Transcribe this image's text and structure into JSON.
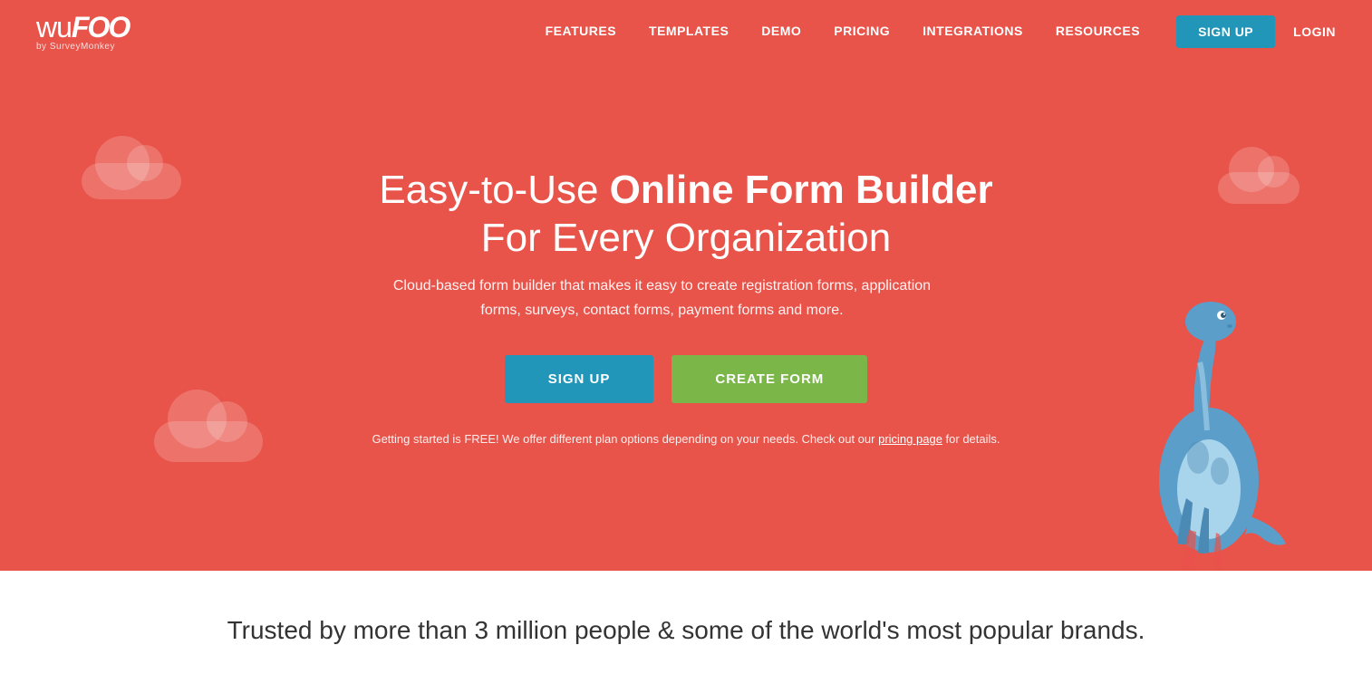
{
  "nav": {
    "logo": "wuFOO",
    "logo_sub": "by SurveyMonkey",
    "links": [
      {
        "label": "FEATURES",
        "href": "#"
      },
      {
        "label": "TEMPLATES",
        "href": "#"
      },
      {
        "label": "DEMO",
        "href": "#"
      },
      {
        "label": "PRICING",
        "href": "#"
      },
      {
        "label": "INTEGRATIONS",
        "href": "#"
      },
      {
        "label": "RESOURCES",
        "href": "#"
      }
    ],
    "signup_label": "SIGN UP",
    "login_label": "LOGIN"
  },
  "hero": {
    "title_normal": "Easy-to-Use ",
    "title_bold": "Online Form Builder",
    "title_line2": "For Every Organization",
    "subtitle": "Cloud-based form builder that makes it easy to create registration forms, application forms, surveys, contact forms, payment forms and more.",
    "signup_btn": "SIGN UP",
    "create_form_btn": "CREATE FORM",
    "note_text": "Getting started is FREE! We offer different plan options depending on your needs. Check out our ",
    "note_link": "pricing page",
    "note_end": " for details."
  },
  "trust": {
    "title": "Trusted by more than 3 million people & some of the world's most popular brands."
  },
  "colors": {
    "hero_bg": "#e8534a",
    "signup_btn": "#2196b8",
    "create_form_btn": "#7ab648"
  }
}
